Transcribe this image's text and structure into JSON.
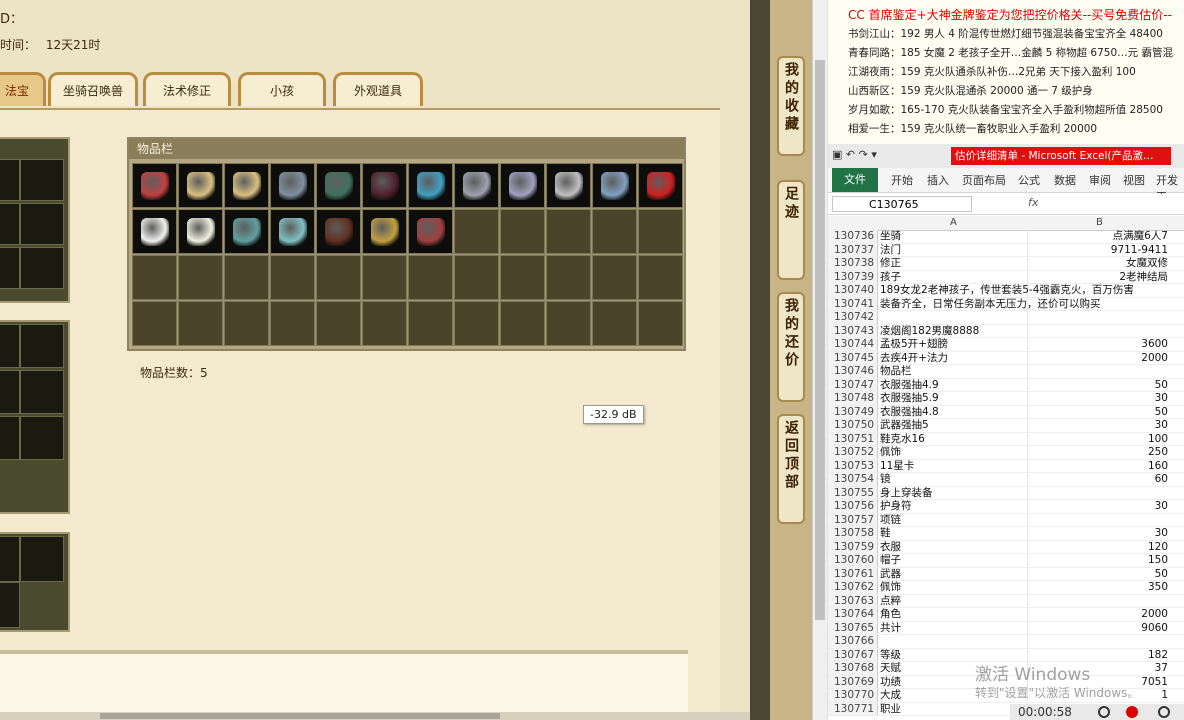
{
  "game": {
    "id_label": "D：",
    "time_label": "时间：",
    "time_value": "12天21时",
    "tabs": [
      {
        "label": "法宝",
        "active": true
      },
      {
        "label": "坐骑召唤兽",
        "active": false
      },
      {
        "label": "法术修正",
        "active": false
      },
      {
        "label": "小孩",
        "active": false
      },
      {
        "label": "外观道具",
        "active": false
      }
    ],
    "inventory_title": "物品栏",
    "inventory_count_label": "物品栏数：5",
    "tooltip": "-32.9 dB",
    "filled_slots": 19,
    "total_slots": 48
  },
  "sidenav": [
    {
      "label": "我的收藏"
    },
    {
      "label": "足迹"
    },
    {
      "label": "我的还价"
    },
    {
      "label": "返回顶部"
    }
  ],
  "ticker": [
    "CC 首席鉴定+大神金牌鉴定为您把控价格关--买号免费估价--",
    "书剑江山：192 男人 4 阶混传世燃灯细节强混装备宝宝齐全 48400",
    "青春同路：185 女魔 2 老孩子全开…金麟 5 称物超 6750…元 霸管混",
    "江湖夜雨：159 克火队通杀队补伤…2兄弟 天下接入盈利 100",
    "山西新区：159 克火队混通杀 20000 通一 7 级护身",
    "岁月如歌：165-170 克火队装备宝宝齐全入手盈利物超所值 28500",
    "相爱一生：159 克火队统一畜牧职业入手盈利 20000"
  ],
  "excel": {
    "title": "估价详细清单 - Microsoft Excel(产品激…",
    "ribbon_tabs": [
      "文件",
      "开始",
      "插入",
      "页面布局",
      "公式",
      "数据",
      "审阅",
      "视图",
      "开发工"
    ],
    "name_box": "C130765",
    "fx": "fx",
    "col_a": "A",
    "col_b": "B",
    "rows": [
      {
        "n": "130736",
        "a": "坐骑",
        "b": "点满魔6人7"
      },
      {
        "n": "130737",
        "a": "法门",
        "b": "9711-9411"
      },
      {
        "n": "130738",
        "a": "修正",
        "b": "女魔双修"
      },
      {
        "n": "130739",
        "a": "孩子",
        "b": "2老神结局"
      },
      {
        "n": "130740",
        "a": "189女龙2老神孩子，传世套装5-4强霸克火，百万伤害",
        "b": ""
      },
      {
        "n": "130741",
        "a": "装备齐全，日常任务副本无压力，还价可以购买",
        "b": ""
      },
      {
        "n": "130742",
        "a": "",
        "b": ""
      },
      {
        "n": "130743",
        "a": "凌烟阁182男魔8888",
        "b": ""
      },
      {
        "n": "130744",
        "a": "孟极5开+翅膀",
        "b": "3600"
      },
      {
        "n": "130745",
        "a": "去疾4开+法力",
        "b": "2000"
      },
      {
        "n": "130746",
        "a": "物品栏",
        "b": ""
      },
      {
        "n": "130747",
        "a": "衣服强抽4.9",
        "b": "50"
      },
      {
        "n": "130748",
        "a": "衣服强抽5.9",
        "b": "30"
      },
      {
        "n": "130749",
        "a": "衣服强抽4.8",
        "b": "50"
      },
      {
        "n": "130750",
        "a": "武器强抽5",
        "b": "30"
      },
      {
        "n": "130751",
        "a": "鞋克水16",
        "b": "100"
      },
      {
        "n": "130752",
        "a": "佩饰",
        "b": "250"
      },
      {
        "n": "130753",
        "a": "11星卡",
        "b": "160"
      },
      {
        "n": "130754",
        "a": "镜",
        "b": "60"
      },
      {
        "n": "130755",
        "a": "身上穿装备",
        "b": ""
      },
      {
        "n": "130756",
        "a": "护身符",
        "b": "30"
      },
      {
        "n": "130757",
        "a": "项链",
        "b": ""
      },
      {
        "n": "130758",
        "a": "鞋",
        "b": "30"
      },
      {
        "n": "130759",
        "a": "衣服",
        "b": "120"
      },
      {
        "n": "130760",
        "a": "帽子",
        "b": "150"
      },
      {
        "n": "130761",
        "a": "武器",
        "b": "50"
      },
      {
        "n": "130762",
        "a": "佩饰",
        "b": "350"
      },
      {
        "n": "130763",
        "a": "点粹",
        "b": ""
      },
      {
        "n": "130764",
        "a": "角色",
        "b": "2000"
      },
      {
        "n": "130765",
        "a": "共计",
        "b": "9060"
      },
      {
        "n": "130766",
        "a": "",
        "b": ""
      },
      {
        "n": "130767",
        "a": "等级",
        "b": "182"
      },
      {
        "n": "130768",
        "a": "天赋",
        "b": "37"
      },
      {
        "n": "130769",
        "a": "功绩",
        "b": "7051"
      },
      {
        "n": "130770",
        "a": "大成",
        "b": "1"
      },
      {
        "n": "130771",
        "a": "职业",
        "b": ""
      }
    ]
  },
  "watermark": {
    "line1": "激活 Windows",
    "line2": "转到\"设置\"以激活 Windows。"
  },
  "recorder": {
    "time": "00:00:58"
  },
  "item_colors": [
    "#c04040",
    "#d8c080",
    "#d8c080",
    "#8090a0",
    "#407060",
    "#502030",
    "#40a0c0",
    "#a0a0b0",
    "#a0a0c0",
    "#c0c0c0",
    "#80a0c0",
    "#d02020",
    "#f0f0f0",
    "#f0f0e0",
    "#60a0a0",
    "#80c0c0",
    "#603020",
    "#c0a040",
    "#a04040"
  ]
}
